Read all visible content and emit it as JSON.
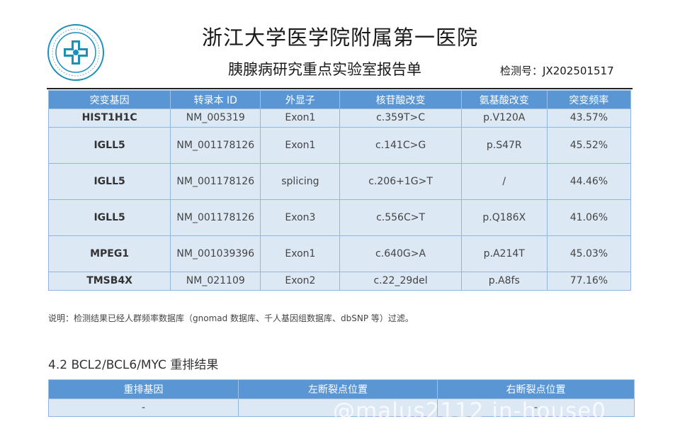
{
  "header": {
    "hospital_name": "浙江大学医学院附属第一医院",
    "lab_report_title": "胰腺病研究重点实验室报告单",
    "report_number_label": "检测号：",
    "report_number": "JX202501517"
  },
  "logo": {
    "icon": "hospital-seal-logo",
    "accent": "#1e8fb8"
  },
  "mutation_table": {
    "headers": [
      "突变基因",
      "转录本 ID",
      "外显子",
      "核苷酸改变",
      "氨基酸改变",
      "突变频率"
    ],
    "rows": [
      {
        "gene": "HIST1H1C",
        "transcript": "NM_005319",
        "exon": "Exon1",
        "nucleotide": "c.359T>C",
        "amino_acid": "p.V120A",
        "frequency": "43.57%"
      },
      {
        "gene": "IGLL5",
        "transcript": "NM_001178126",
        "exon": "Exon1",
        "nucleotide": "c.141C>G",
        "amino_acid": "p.S47R",
        "frequency": "45.52%"
      },
      {
        "gene": "IGLL5",
        "transcript": "NM_001178126",
        "exon": "splicing",
        "nucleotide": "c.206+1G>T",
        "amino_acid": "/",
        "frequency": "44.46%"
      },
      {
        "gene": "IGLL5",
        "transcript": "NM_001178126",
        "exon": "Exon3",
        "nucleotide": "c.556C>T",
        "amino_acid": "p.Q186X",
        "frequency": "41.06%"
      },
      {
        "gene": "MPEG1",
        "transcript": "NM_001039396",
        "exon": "Exon1",
        "nucleotide": "c.640G>A",
        "amino_acid": "p.A214T",
        "frequency": "45.03%"
      },
      {
        "gene": "TMSB4X",
        "transcript": "NM_021109",
        "exon": "Exon2",
        "nucleotide": "c.22_29del",
        "amino_acid": "p.A8fs",
        "frequency": "77.16%"
      }
    ]
  },
  "note": "说明：检测结果已经人群频率数据库（gnomad 数据库、千人基因组数据库、dbSNP 等）过滤。",
  "rearrangement": {
    "section_title": "4.2  BCL2/BCL6/MYC 重排结果",
    "headers": [
      "重排基因",
      "左断裂点位置",
      "右断裂点位置"
    ],
    "row": [
      "-",
      "",
      "-"
    ]
  },
  "watermark": "@malus2112 in-house0",
  "colors": {
    "header_bg": "#5b96d4",
    "cell_bg": "#dde8f5",
    "border": "#8fb5e0"
  }
}
